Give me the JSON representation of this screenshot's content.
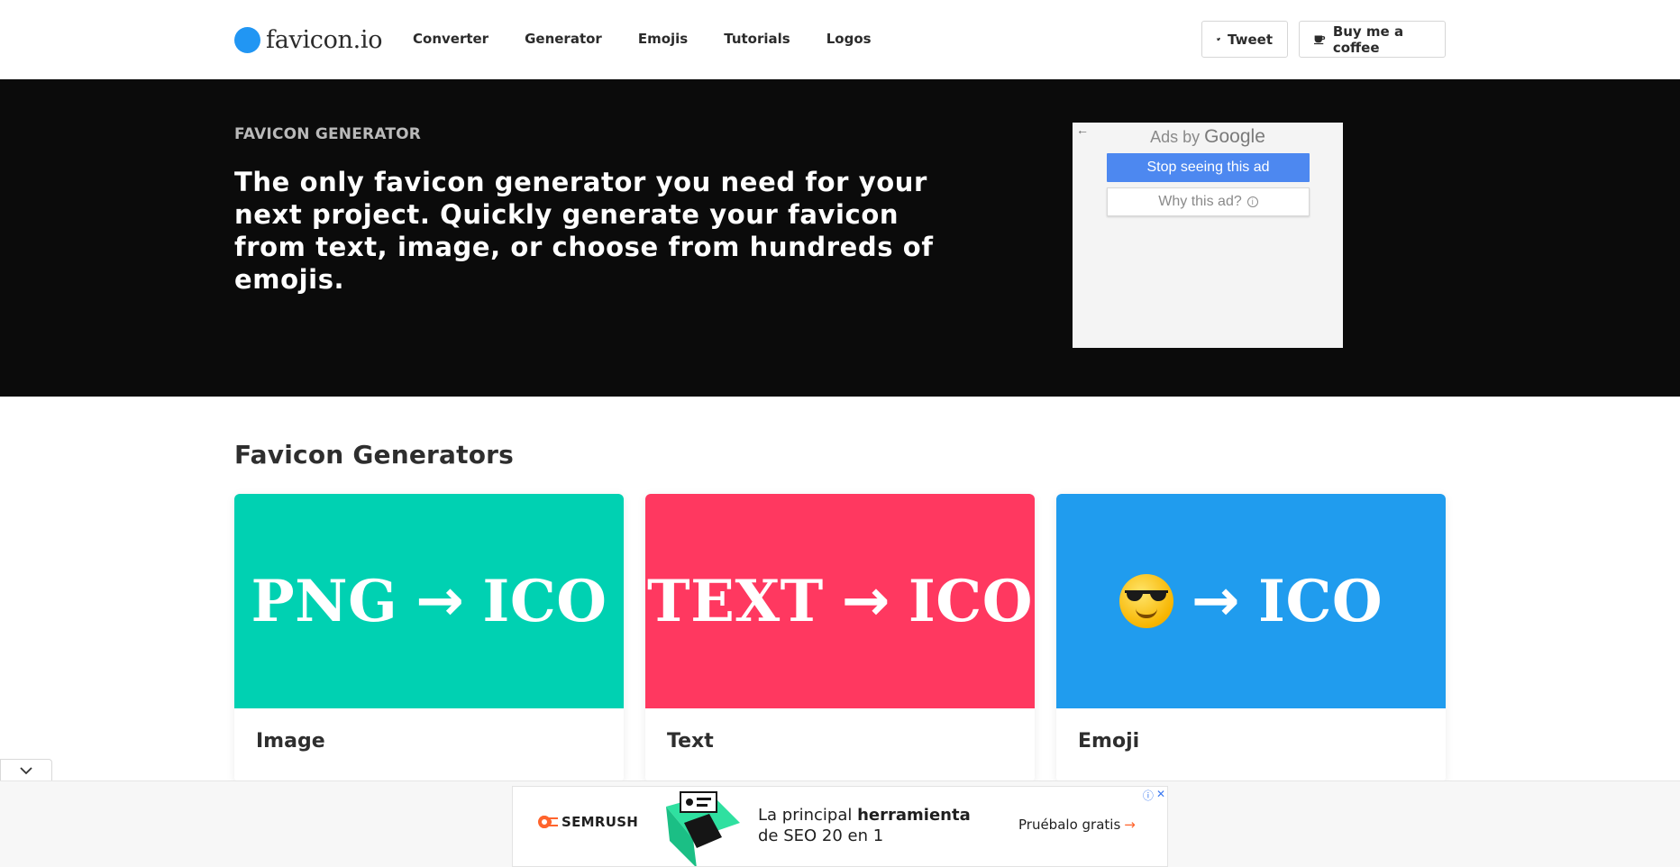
{
  "brand": {
    "name": "favicon.io",
    "color": "#2196f3"
  },
  "nav": {
    "items": [
      "Converter",
      "Generator",
      "Emojis",
      "Tutorials",
      "Logos"
    ],
    "tweet_label": "Tweet",
    "coffee_label": "Buy me a coffee"
  },
  "hero": {
    "eyebrow": "FAVICON GENERATOR",
    "title": "The only favicon generator you need for your next project. Quickly generate your favicon from text, image, or choose from hundreds of emojis."
  },
  "ad": {
    "ads_by": "Ads by",
    "google": "Google",
    "stop_label": "Stop seeing this ad",
    "why_label": "Why this ad?",
    "back_icon": "back-arrow-icon",
    "info_icon": "info-icon"
  },
  "generators": {
    "title": "Favicon Generators",
    "cards": [
      {
        "from": "PNG",
        "arrow": "→",
        "to": "ICO",
        "label": "Image",
        "color": "#00d1b2"
      },
      {
        "from": "TEXT",
        "arrow": "→",
        "to": "ICO",
        "label": "Text",
        "color": "#ff3860"
      },
      {
        "from": "sunglasses-emoji",
        "arrow": "→",
        "to": "ICO",
        "label": "Emoji",
        "color": "#209cee"
      }
    ]
  },
  "bottom_ad": {
    "brand": "SEMRUSH",
    "text_prefix": "La principal",
    "text_bold": "herramienta",
    "text_line2": "de SEO 20 en 1",
    "cta": "Pruébalo gratis",
    "cta_arrow": "→",
    "accent": "#ff642d"
  }
}
